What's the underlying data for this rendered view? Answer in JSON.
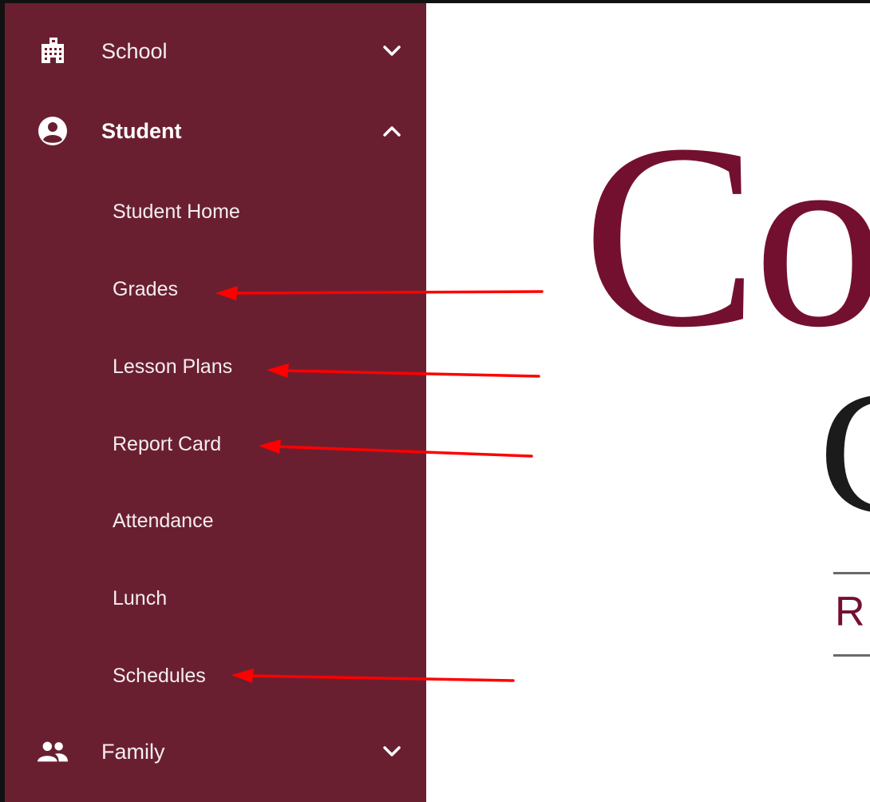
{
  "colors": {
    "sidebar_bg": "#6a1f31",
    "logo_maroon": "#74102f",
    "arrow_red": "#ff0000"
  },
  "sidebar": {
    "sections": [
      {
        "label": "School",
        "icon": "building-icon",
        "expanded": false
      },
      {
        "label": "Student",
        "icon": "account-circle-icon",
        "expanded": true
      },
      {
        "label": "Family",
        "icon": "people-icon",
        "expanded": false
      }
    ],
    "student_items": [
      "Student Home",
      "Grades",
      "Lesson Plans",
      "Report Card",
      "Attendance",
      "Lunch",
      "Schedules"
    ]
  },
  "logo": {
    "line1": "Co",
    "line2": "C",
    "line3": "R"
  },
  "annotations": {
    "arrow_targets": [
      "Grades",
      "Lesson Plans",
      "Report Card",
      "Schedules"
    ]
  }
}
